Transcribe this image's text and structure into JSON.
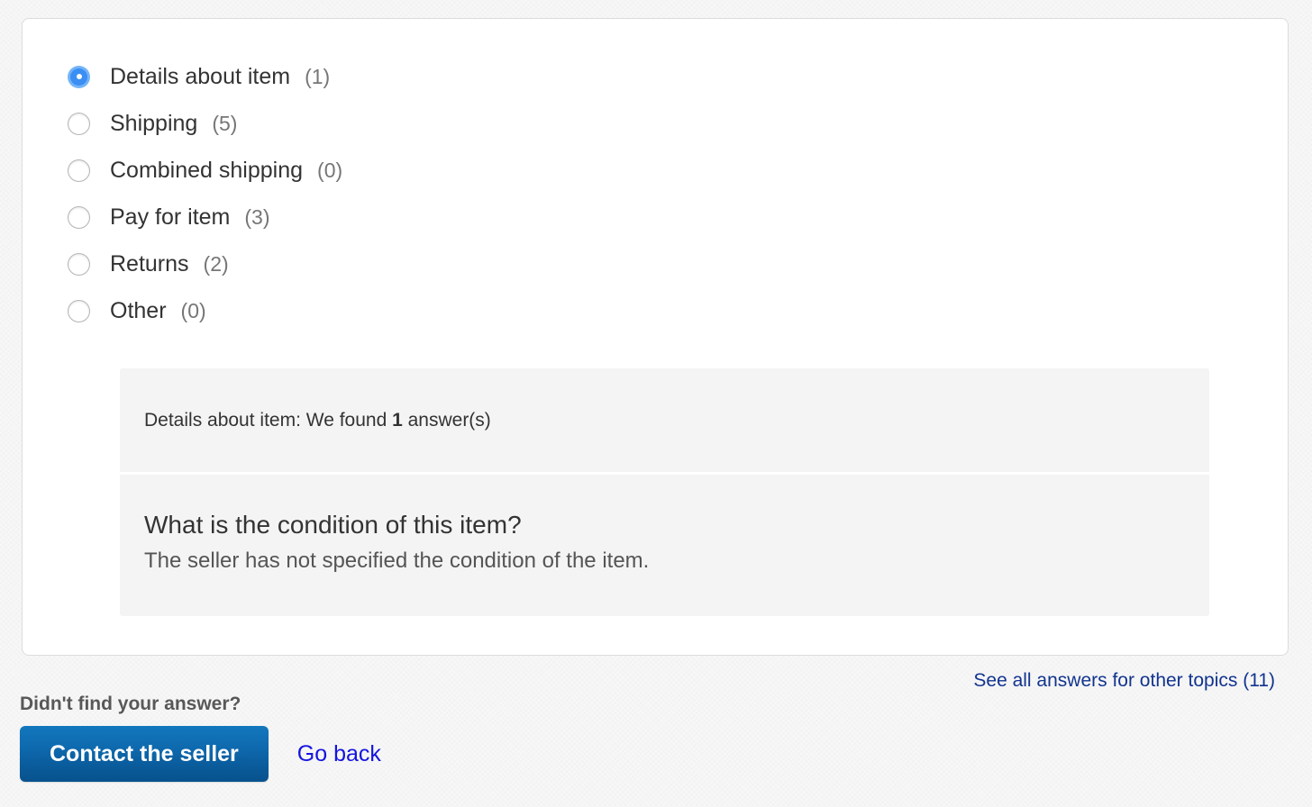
{
  "topics": {
    "items": [
      {
        "label": "Details about item",
        "count": "(1)",
        "selected": true
      },
      {
        "label": "Shipping",
        "count": "(5)",
        "selected": false
      },
      {
        "label": "Combined shipping",
        "count": "(0)",
        "selected": false
      },
      {
        "label": "Pay for item",
        "count": "(3)",
        "selected": false
      },
      {
        "label": "Returns",
        "count": "(2)",
        "selected": false
      },
      {
        "label": "Other",
        "count": "(0)",
        "selected": false
      }
    ]
  },
  "answers_panel": {
    "summary_prefix": "Details about item: We found ",
    "summary_count": "1",
    "summary_suffix": " answer(s)",
    "question": "What is the condition of this item?",
    "answer": "The seller has not specified the condition of the item."
  },
  "links": {
    "see_all": "See all answers for other topics (11)",
    "go_back": "Go back"
  },
  "bottom": {
    "heading": "Didn't find your answer?",
    "contact_button": "Contact the seller"
  },
  "colors": {
    "accent_blue": "#3b8ef3",
    "button_blue": "#0a5c9c",
    "link_blue": "#12348f",
    "go_back_blue": "#1414e0",
    "panel_gray": "#f4f4f4",
    "text_dark": "#333333",
    "text_muted": "#767676"
  }
}
